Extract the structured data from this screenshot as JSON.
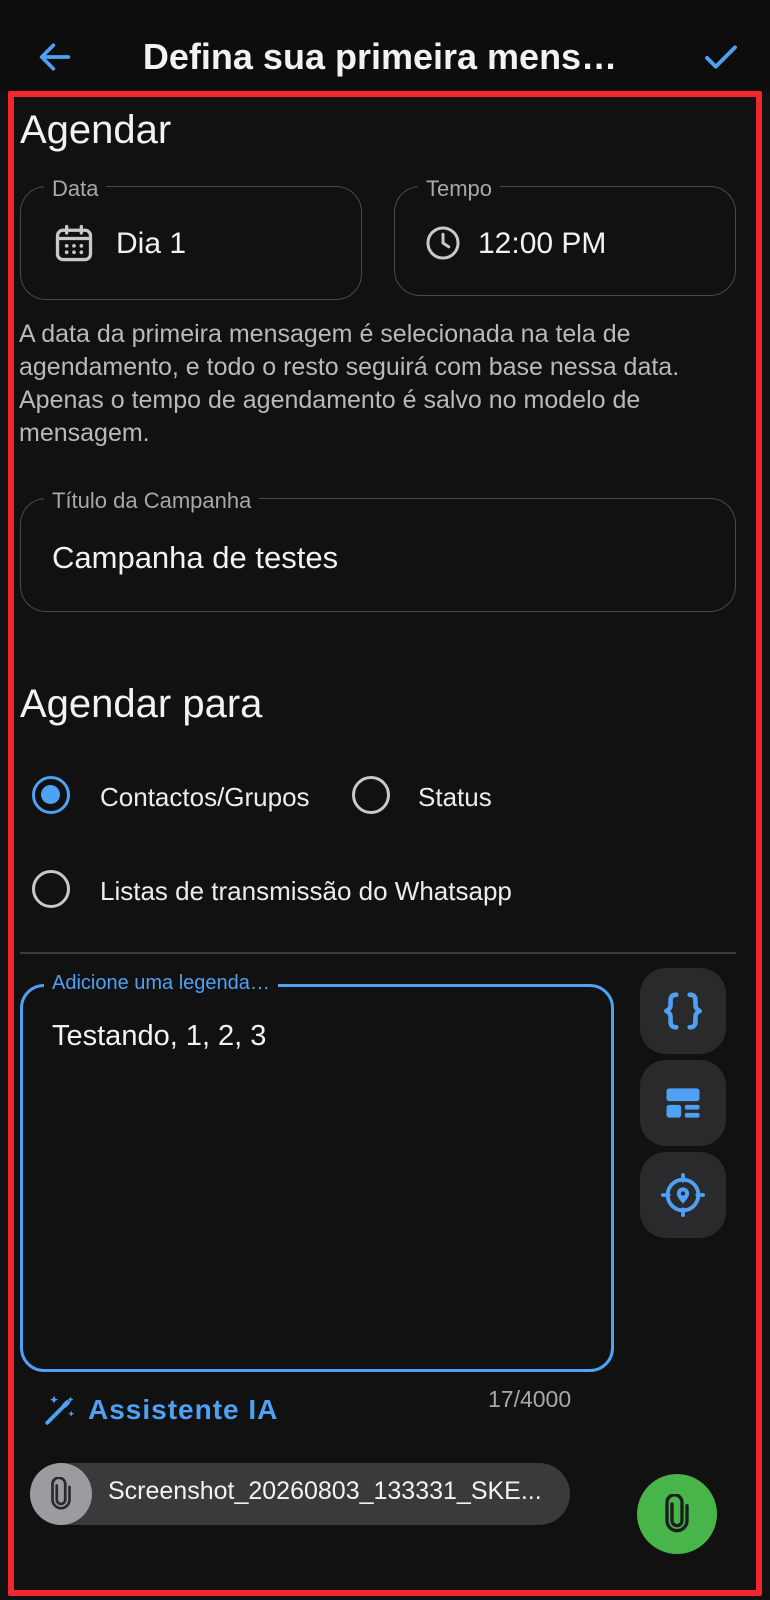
{
  "colors": {
    "accent": "#4ea1f3",
    "background": "#111112",
    "highlight_frame": "#f0282d",
    "fab": "#47b54a"
  },
  "appbar": {
    "title": "Defina sua primeira mens…",
    "back_icon": "arrow-left-icon",
    "confirm_icon": "check-icon"
  },
  "schedule": {
    "title": "Agendar",
    "date": {
      "label": "Data",
      "value": "Dia 1",
      "icon": "calendar-icon"
    },
    "time": {
      "label": "Tempo",
      "value": "12:00 PM",
      "icon": "clock-icon"
    },
    "help_text": "A data da primeira mensagem é selecionada na tela de agendamento, e todo o resto seguirá com base nessa data. Apenas o tempo de agendamento é salvo no modelo de mensagem."
  },
  "campaign": {
    "label": "Título da Campanha",
    "value": "Campanha de testes"
  },
  "schedule_for": {
    "title": "Agendar para",
    "options": [
      {
        "label": "Contactos/Grupos",
        "selected": true
      },
      {
        "label": "Status",
        "selected": false
      },
      {
        "label": "Listas de transmissão do Whatsapp",
        "selected": false
      }
    ]
  },
  "caption": {
    "label": "Adicione uma legenda…",
    "value": "Testando, 1, 2, 3",
    "counter": "17/4000",
    "side_buttons": [
      "curly-braces-icon",
      "template-icon",
      "location-icon"
    ]
  },
  "ai_assistant": {
    "label": "Assistente IA",
    "icon": "magic-wand-icon"
  },
  "attachment": {
    "file_name": "Screenshot_20260803_133331_SKE...",
    "icon": "paperclip-icon"
  },
  "fab": {
    "icon": "paperclip-icon"
  }
}
